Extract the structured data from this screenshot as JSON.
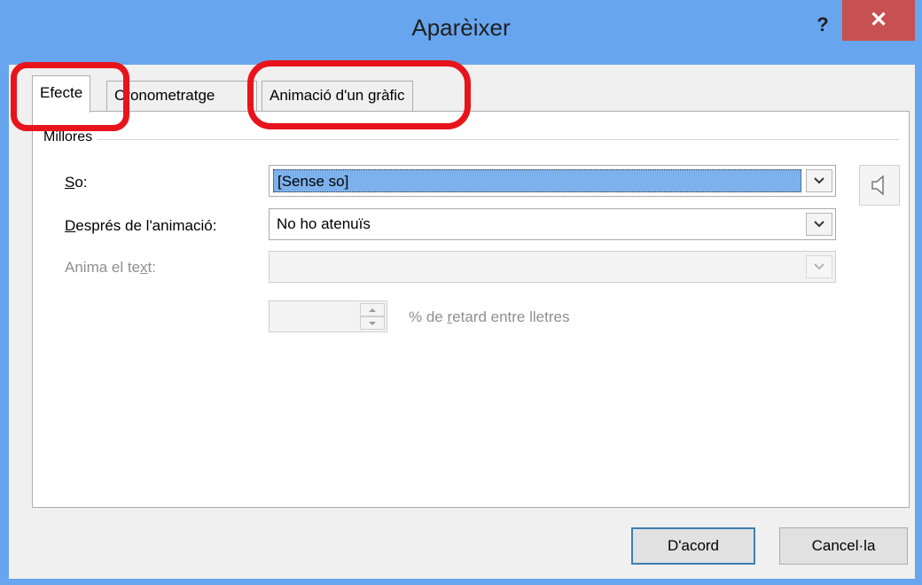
{
  "dialog": {
    "title": "Aparèixer",
    "help_label": "?",
    "close_label": "✕"
  },
  "tabs": [
    {
      "label": "Efecte",
      "active": true
    },
    {
      "label": "Cronometratge",
      "active": false
    },
    {
      "label": "Animació d'un gràfic",
      "active": false
    }
  ],
  "group": {
    "label": "Millores"
  },
  "sound": {
    "label_access": "S",
    "label_rest": "o:",
    "value": "[Sense so]"
  },
  "after_animation": {
    "label_access": "D",
    "label_rest": "esprés de l'animació:",
    "value": "No ho atenuïs"
  },
  "animate_text": {
    "label_start": "Anima el te",
    "label_access": "x",
    "label_rest": "t:",
    "value": ""
  },
  "delay": {
    "value": "",
    "label_start": "% de ",
    "label_access": "r",
    "label_rest": "etard entre lletres"
  },
  "buttons": {
    "ok": "D'acord",
    "cancel": "Cancel·la"
  },
  "colors": {
    "titlebar": "#67a5ef",
    "close": "#c75050",
    "highlight": "#e8141c",
    "selection": "#7cb1ec"
  }
}
